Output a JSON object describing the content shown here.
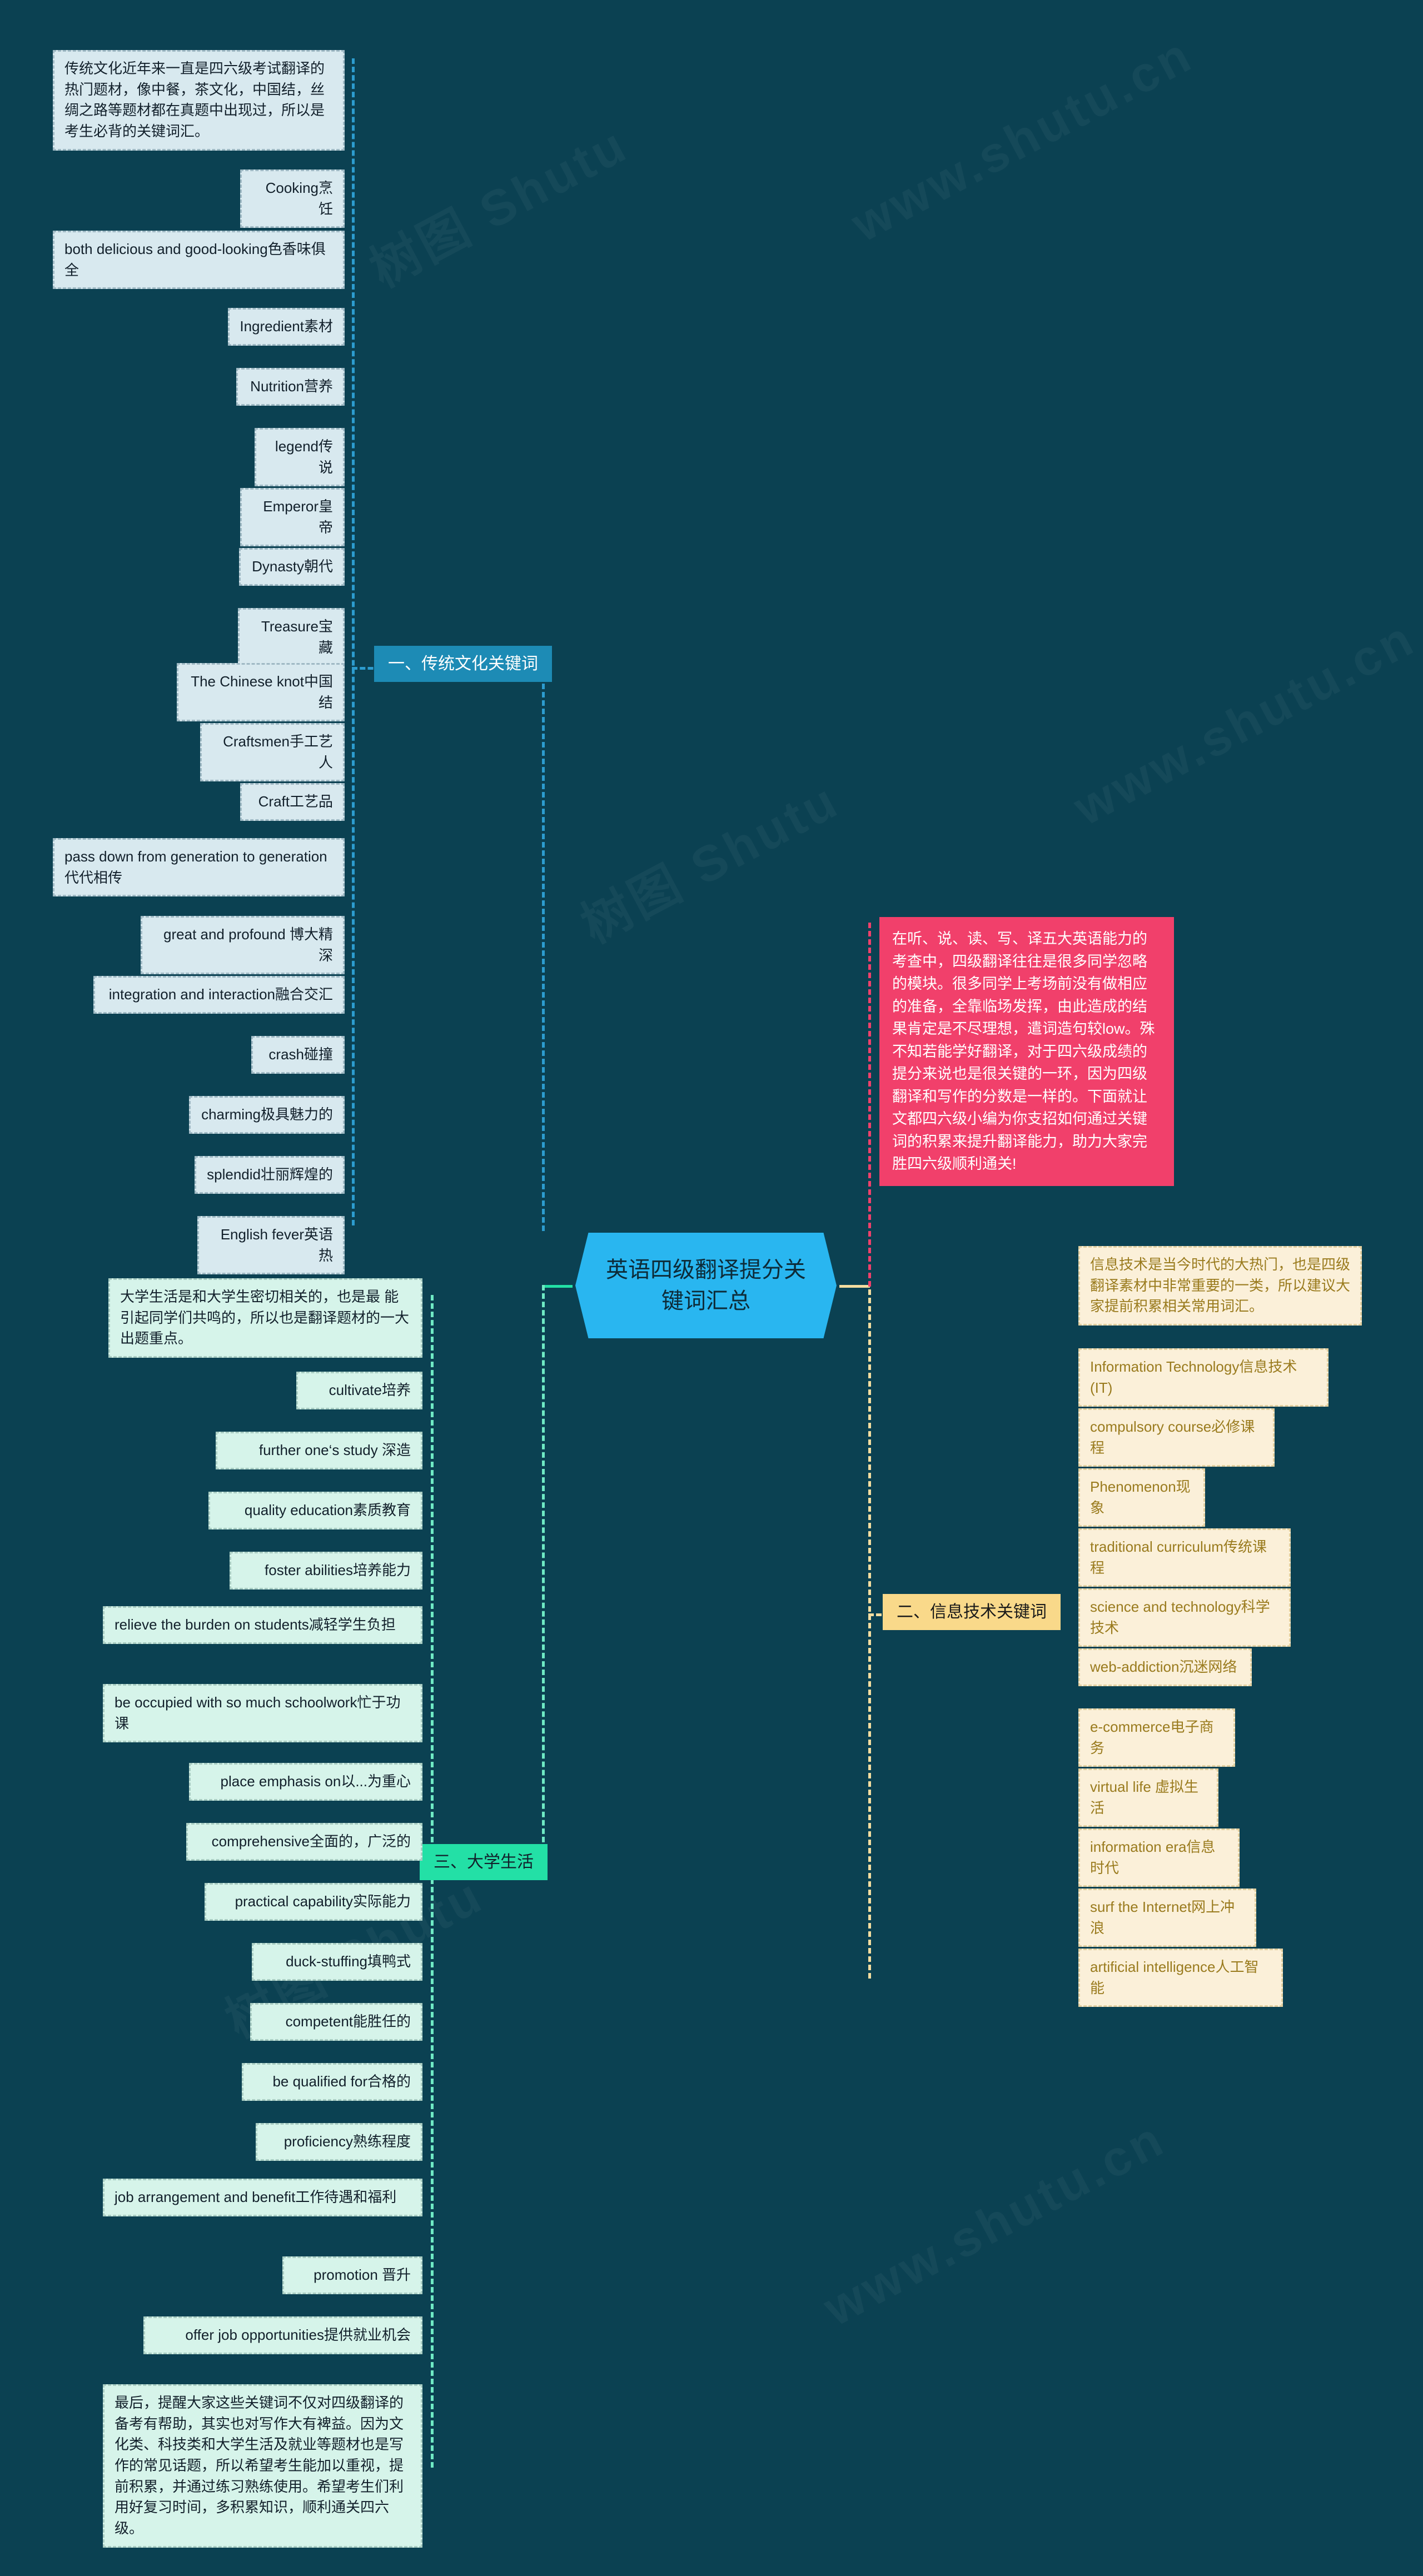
{
  "center": {
    "title": "英语四级翻译提分关键词汇总"
  },
  "intro": {
    "text": "在听、说、读、写、译五大英语能力的考查中，四级翻译往往是很多同学忽略的模块。很多同学上考场前没有做相应的准备，全靠临场发挥，由此造成的结果肯定是不尽理想，遣词造句较low。殊不知若能学好翻译，对于四六级成绩的提分来说也是很关键的一环，因为四级翻译和写作的分数是一样的。下面就让文都四六级小编为你支招如何通过关键词的积累来提升翻译能力，助力大家完胜四六级顺利通关!"
  },
  "branches": [
    {
      "id": "traditional-culture",
      "label": "一、传统文化关键词",
      "color": "#1d8bb5",
      "node_bg": "#d8e9ef",
      "items": [
        "传统文化近年来一直是四六级考试翻译的热门题材，像中餐，茶文化，中国结，丝绸之路等题材都在真题中出现过，所以是考生必背的关键词汇。",
        "Cooking烹饪",
        "both delicious and good-looking色香味俱全",
        "Ingredient素材",
        "Nutrition营养",
        "legend传说",
        "Emperor皇帝",
        "Dynasty朝代",
        "Treasure宝藏",
        "The Chinese knot中国结",
        "Craftsmen手工艺人",
        "Craft工艺品",
        "pass down from generation to generation代代相传",
        "great and profound 博大精深",
        "integration and interaction融合交汇",
        "crash碰撞",
        "charming极具魅力的",
        "splendid壮丽辉煌的",
        "English fever英语热"
      ]
    },
    {
      "id": "information-technology",
      "label": "二、信息技术关键词",
      "color": "#f9d98a",
      "node_bg": "#fbf0d9",
      "items": [
        "信息技术是当今时代的大热门，也是四级翻译素材中非常重要的一类，所以建议大家提前积累相关常用词汇。",
        "Information Technology信息技术(IT)",
        "compulsory course必修课程",
        "Phenomenon现象",
        "traditional curriculum传统课程",
        "science and technology科学技术",
        "web-addiction沉迷网络",
        "e-commerce电子商务",
        "virtual life 虚拟生活",
        "information era信息时代",
        "surf the Internet网上冲浪",
        "artificial intelligence人工智能"
      ]
    },
    {
      "id": "college-life",
      "label": "三、大学生活",
      "color": "#23e0a6",
      "node_bg": "#d6f4ea",
      "items": [
        "大学生活是和大学生密切相关的，也是最 能引起同学们共鸣的，所以也是翻译题材的一大出题重点。",
        "cultivate培养",
        "further one‘s study 深造",
        "quality education素质教育",
        "foster abilities培养能力",
        "relieve the burden on students减轻学生负担",
        "be occupied with so much schoolwork忙于功课",
        "place emphasis on以...为重心",
        "comprehensive全面的，广泛的",
        "practical capability实际能力",
        "duck-stuffing填鸭式",
        "competent能胜任的",
        "be qualified for合格的",
        "proficiency熟练程度",
        "job arrangement and benefit工作待遇和福利",
        "promotion 晋升",
        "offer job opportunities提供就业机会",
        "最后，提醒大家这些关键词不仅对四级翻译的备考有帮助，其实也对写作大有裨益。因为文化类、科技类和大学生活及就业等题材也是写作的常见话题，所以希望考生能加以重视，提前积累，并通过练习熟练使用。希望考生们利用好复习时间，多积累知识，顺利通关四六级。"
      ]
    }
  ],
  "watermarks": [
    "树图 Shutu",
    "www.shutu.cn",
    "树图 Shutu",
    "www.shutu.cn",
    "树图 Shutu",
    "www.shutu.cn"
  ],
  "colors": {
    "background": "#0b4152",
    "center_node": "#29b6f0",
    "branch1": "#1d8bb5",
    "branch2": "#f9d98a",
    "branch3": "#23e0a6",
    "intro": "#f1406b"
  }
}
